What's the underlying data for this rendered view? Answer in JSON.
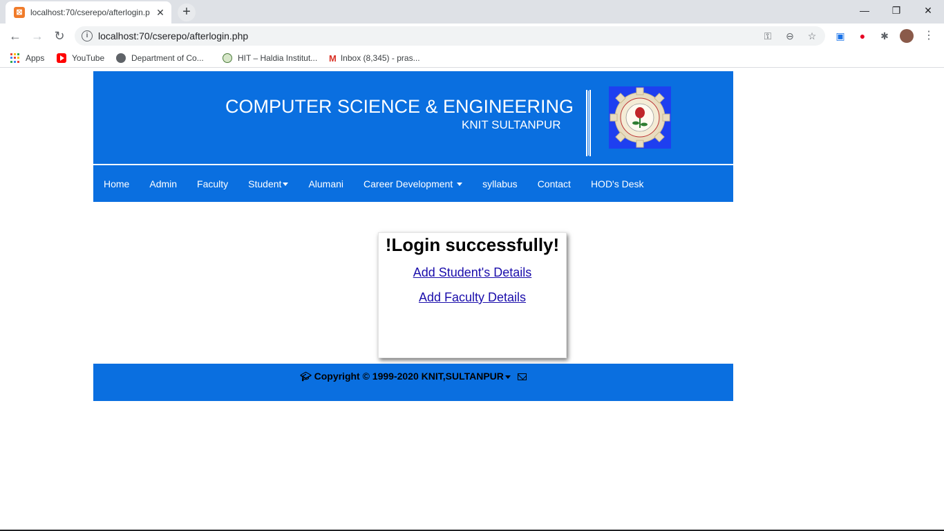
{
  "browser": {
    "tab_title": "localhost:70/cserepo/afterlogin.p",
    "tab_close": "✕",
    "new_tab": "+",
    "url": "localhost:70/cserepo/afterlogin.php",
    "window_controls": {
      "minimize": "—",
      "restore": "❐",
      "close": "✕"
    },
    "bookmarks": [
      {
        "label": "Apps",
        "icon": "apps-grid-icon"
      },
      {
        "label": "YouTube",
        "icon": "youtube-icon"
      },
      {
        "label": "Department of Co...",
        "icon": "globe-icon"
      },
      {
        "label": "HIT – Haldia Institut...",
        "icon": "hit-logo-icon"
      },
      {
        "label": "Inbox (8,345) - pras...",
        "icon": "gmail-icon"
      }
    ],
    "accent_color": "#0a6fe0"
  },
  "header": {
    "title": "COMPUTER SCIENCE & ENGINEERING",
    "subtitle": "KNIT SULTANPUR"
  },
  "nav": {
    "items": [
      {
        "label": "Home",
        "dropdown": false
      },
      {
        "label": "Admin",
        "dropdown": false
      },
      {
        "label": "Faculty",
        "dropdown": false
      },
      {
        "label": "Student",
        "dropdown": true
      },
      {
        "label": "Alumani",
        "dropdown": false
      },
      {
        "label": "Career Development",
        "dropdown": true
      },
      {
        "label": "syllabus",
        "dropdown": false
      },
      {
        "label": "Contact",
        "dropdown": false
      },
      {
        "label": "HOD's Desk",
        "dropdown": false
      }
    ]
  },
  "card": {
    "title": "!Login successfully!",
    "link_student": "Add Student's Details",
    "link_faculty": "Add Faculty Details"
  },
  "footer": {
    "text": "Copyright © 1999-2020 KNIT,SULTANPUR"
  }
}
